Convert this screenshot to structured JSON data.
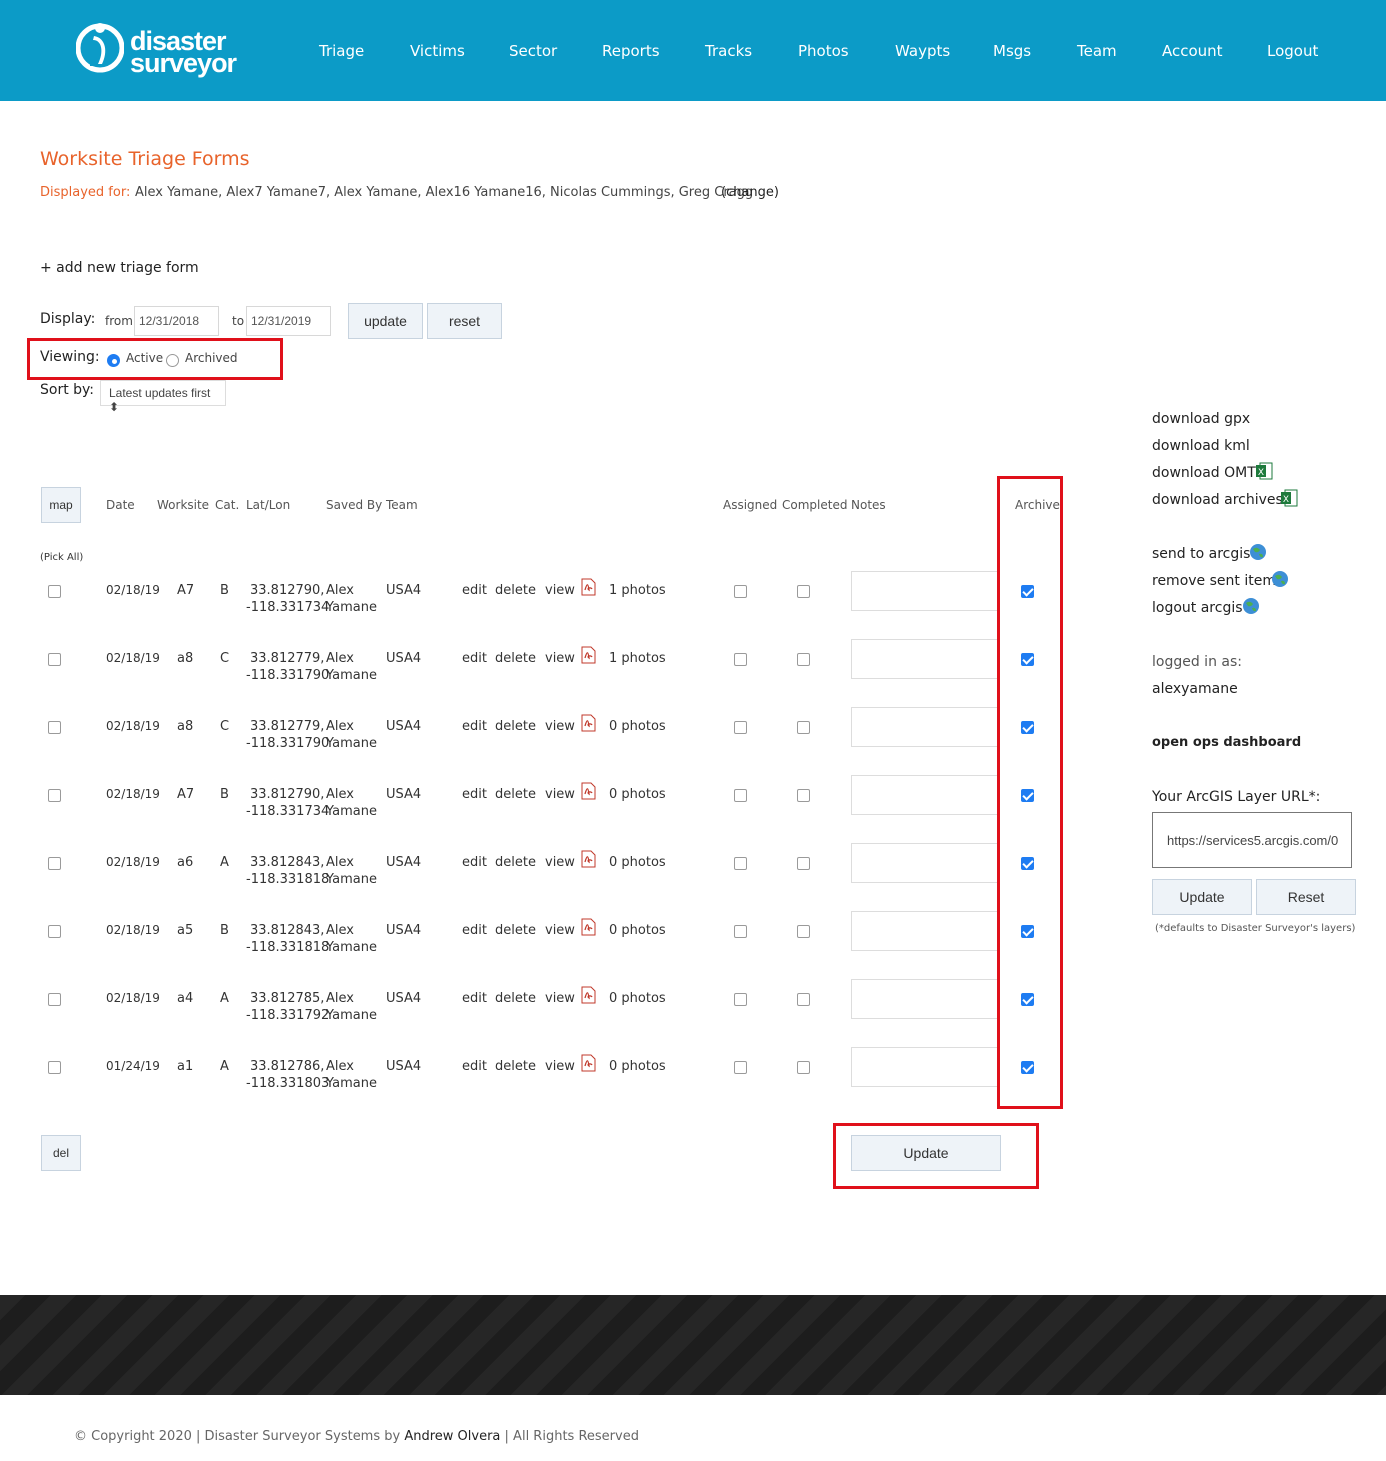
{
  "brand": {
    "line1": "disaster",
    "line2": "surveyor"
  },
  "nav": [
    "Triage",
    "Victims",
    "Sector",
    "Reports",
    "Tracks",
    "Photos",
    "Waypts",
    "Msgs",
    "Team",
    "Account",
    "Logout"
  ],
  "page": {
    "title": "Worksite Triage Forms",
    "displayed_for_label": "Displayed for:",
    "displayed_for_names": "Alex Yamane, Alex7 Yamane7, Alex Yamane, Alex16 Yamane16, Nicolas Cummings, Greg Cragg",
    "change_link": "(change)",
    "add_link": "+ add new triage form"
  },
  "filters": {
    "display_label": "Display:",
    "from_label": "from",
    "from_value": "12/31/2018",
    "to_label": "to",
    "to_value": "12/31/2019",
    "update_btn": "update",
    "reset_btn": "reset",
    "viewing_label": "Viewing:",
    "active_label": "Active",
    "archived_label": "Archived",
    "viewing_selected": "Active",
    "sort_label": "Sort by:",
    "sort_value": "Latest updates first"
  },
  "table": {
    "map_btn": "map",
    "pick_all": "(Pick All)",
    "headers": {
      "date": "Date",
      "worksite": "Worksite",
      "cat": "Cat.",
      "latlon": "Lat/Lon",
      "saved_by": "Saved By",
      "team": "Team",
      "assigned": "Assigned",
      "completed": "Completed",
      "notes": "Notes",
      "archive": "Archive"
    },
    "action_edit": "edit",
    "action_delete": "delete",
    "action_view": "view",
    "rows": [
      {
        "date": "02/18/19",
        "worksite": "A7",
        "cat": "B",
        "lat": "33.812790,",
        "lon": "-118.331734",
        "first": "Alex",
        "last": "Yamane",
        "team": "USA4",
        "photos": "1 photos",
        "archived": true
      },
      {
        "date": "02/18/19",
        "worksite": "a8",
        "cat": "C",
        "lat": "33.812779,",
        "lon": "-118.331790",
        "first": "Alex",
        "last": "Yamane",
        "team": "USA4",
        "photos": "1 photos",
        "archived": true
      },
      {
        "date": "02/18/19",
        "worksite": "a8",
        "cat": "C",
        "lat": "33.812779,",
        "lon": "-118.331790",
        "first": "Alex",
        "last": "Yamane",
        "team": "USA4",
        "photos": "0 photos",
        "archived": true
      },
      {
        "date": "02/18/19",
        "worksite": "A7",
        "cat": "B",
        "lat": "33.812790,",
        "lon": "-118.331734",
        "first": "Alex",
        "last": "Yamane",
        "team": "USA4",
        "photos": "0 photos",
        "archived": true
      },
      {
        "date": "02/18/19",
        "worksite": "a6",
        "cat": "A",
        "lat": "33.812843,",
        "lon": "-118.331818",
        "first": "Alex",
        "last": "Yamane",
        "team": "USA4",
        "photos": "0 photos",
        "archived": true
      },
      {
        "date": "02/18/19",
        "worksite": "a5",
        "cat": "B",
        "lat": "33.812843,",
        "lon": "-118.331818",
        "first": "Alex",
        "last": "Yamane",
        "team": "USA4",
        "photos": "0 photos",
        "archived": true
      },
      {
        "date": "02/18/19",
        "worksite": "a4",
        "cat": "A",
        "lat": "33.812785,",
        "lon": "-118.331792",
        "first": "Alex",
        "last": "Yamane",
        "team": "USA4",
        "photos": "0 photos",
        "archived": true
      },
      {
        "date": "01/24/19",
        "worksite": "a1",
        "cat": "A",
        "lat": "33.812786,",
        "lon": "-118.331803",
        "first": "Alex",
        "last": "Yamane",
        "team": "USA4",
        "photos": "0 photos",
        "archived": true
      }
    ],
    "del_btn": "del",
    "update_btn": "Update"
  },
  "sidebar": {
    "download_gpx": "download gpx",
    "download_kml": "download kml",
    "download_omt": "download OMT",
    "download_archives": "download archives",
    "send_arcgis": "send to arcgis",
    "remove_sent": "remove sent item",
    "logout_arcgis": "logout arcgis",
    "logged_in_label": "logged in as:",
    "username": "alexyamane",
    "ops_dashboard": "open ops dashboard",
    "arcgis_label": "Your ArcGIS Layer URL*:",
    "arcgis_value": "https://services5.arcgis.com/0",
    "update_btn": "Update",
    "reset_btn": "Reset",
    "defaults_note": "(*defaults to Disaster Surveyor's layers)"
  },
  "footer": {
    "copyright_prefix": "© Copyright 2020 | Disaster Surveyor Systems by",
    "author": "Andrew Olvera",
    "suffix": "| All Rights Reserved"
  },
  "icons": {
    "pdf": "pdf-icon",
    "excel": "excel-icon",
    "globe": "globe-icon",
    "logo": "disaster-surveyor-logo"
  },
  "colors": {
    "header": "#0c9bc7",
    "title": "#e8632b",
    "highlight": "#e0101a",
    "checkbox": "#1e7cf2",
    "footer": "#222222"
  }
}
